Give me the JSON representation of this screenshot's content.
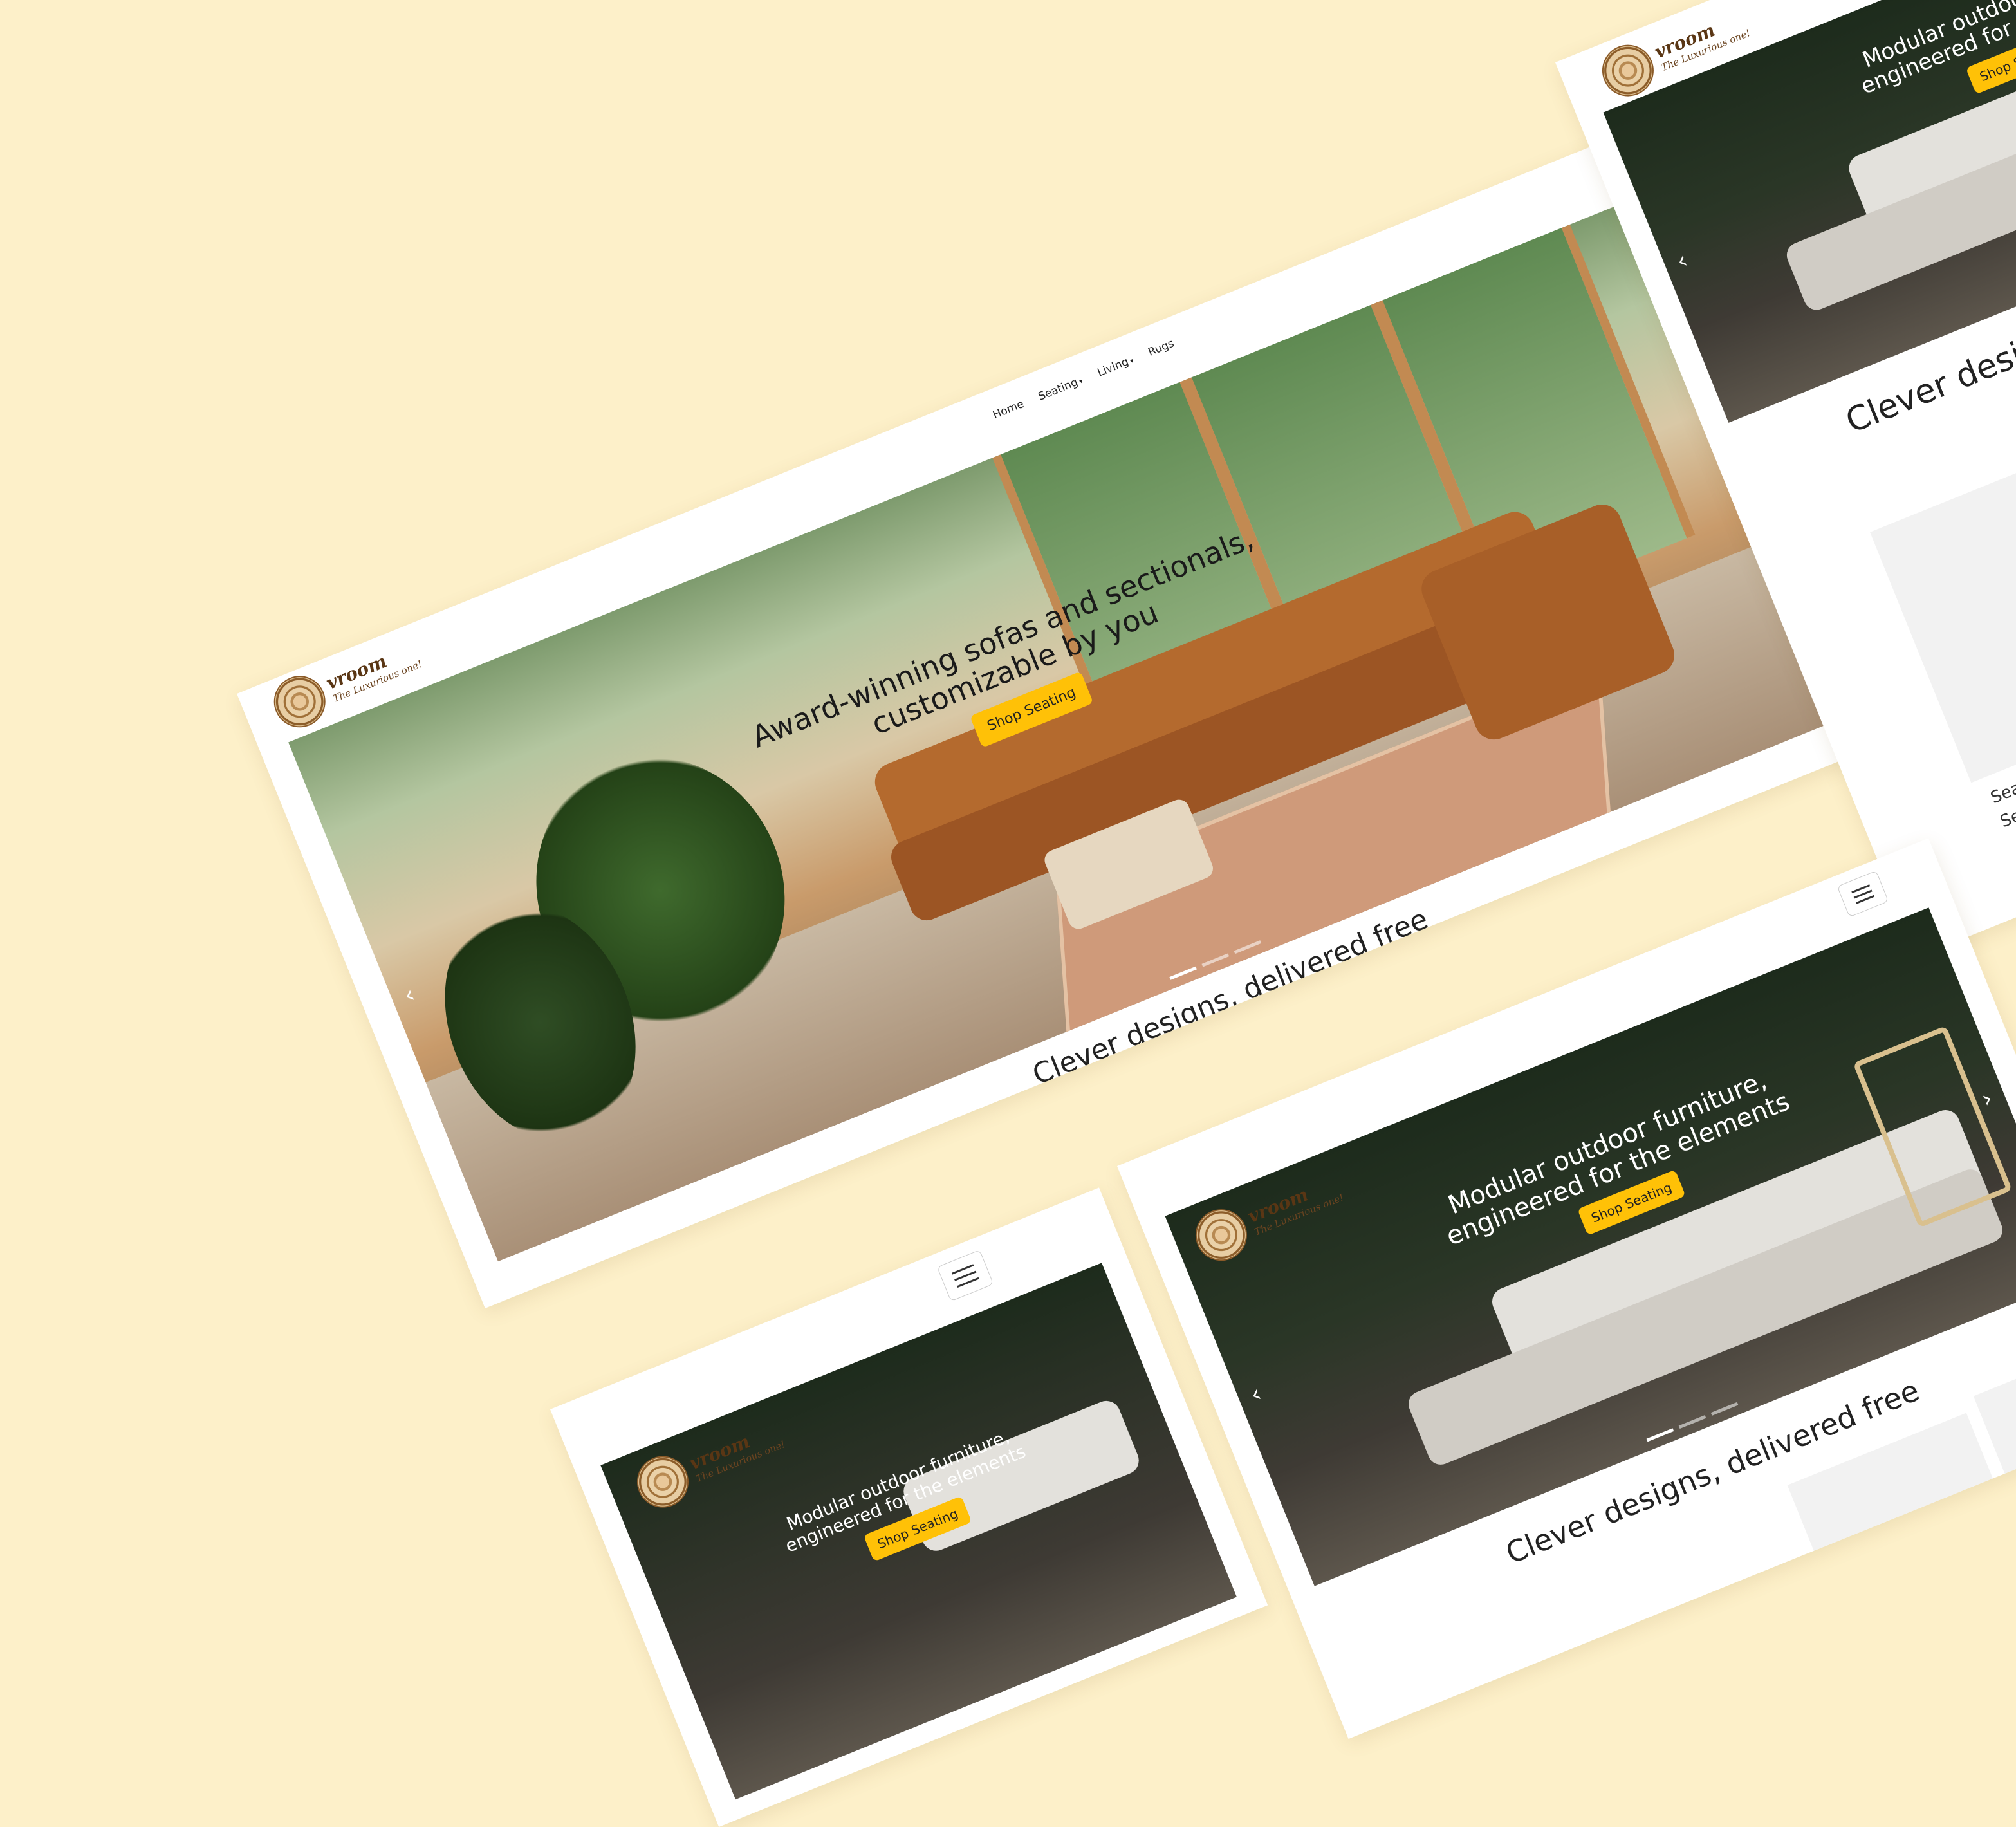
{
  "brand": {
    "name": "vroom",
    "tagline": "The Luxurious one!"
  },
  "nav": {
    "items": [
      {
        "label": "Home",
        "dropdown": false
      },
      {
        "label": "Seating",
        "dropdown": true
      },
      {
        "label": "Living",
        "dropdown": true
      },
      {
        "label": "Rugs",
        "dropdown": false
      }
    ],
    "user_icon": "user-icon"
  },
  "hero_main": {
    "title": "Award-winning sofas and sectionals, customizable by you",
    "button": "Shop Seating",
    "slides": 3,
    "active_slide": 1
  },
  "hero_outdoor": {
    "title": "Modular outdoor furniture, engineered for the elements",
    "button": "Shop Seating"
  },
  "section": {
    "heading": "Clever designs, delivered free"
  },
  "products": [
    {
      "label": "Seating"
    },
    {
      "label": "Seating"
    }
  ],
  "colors": {
    "background": "#fdf0c9",
    "accent": "#ffc107",
    "card": "#ffffff"
  }
}
